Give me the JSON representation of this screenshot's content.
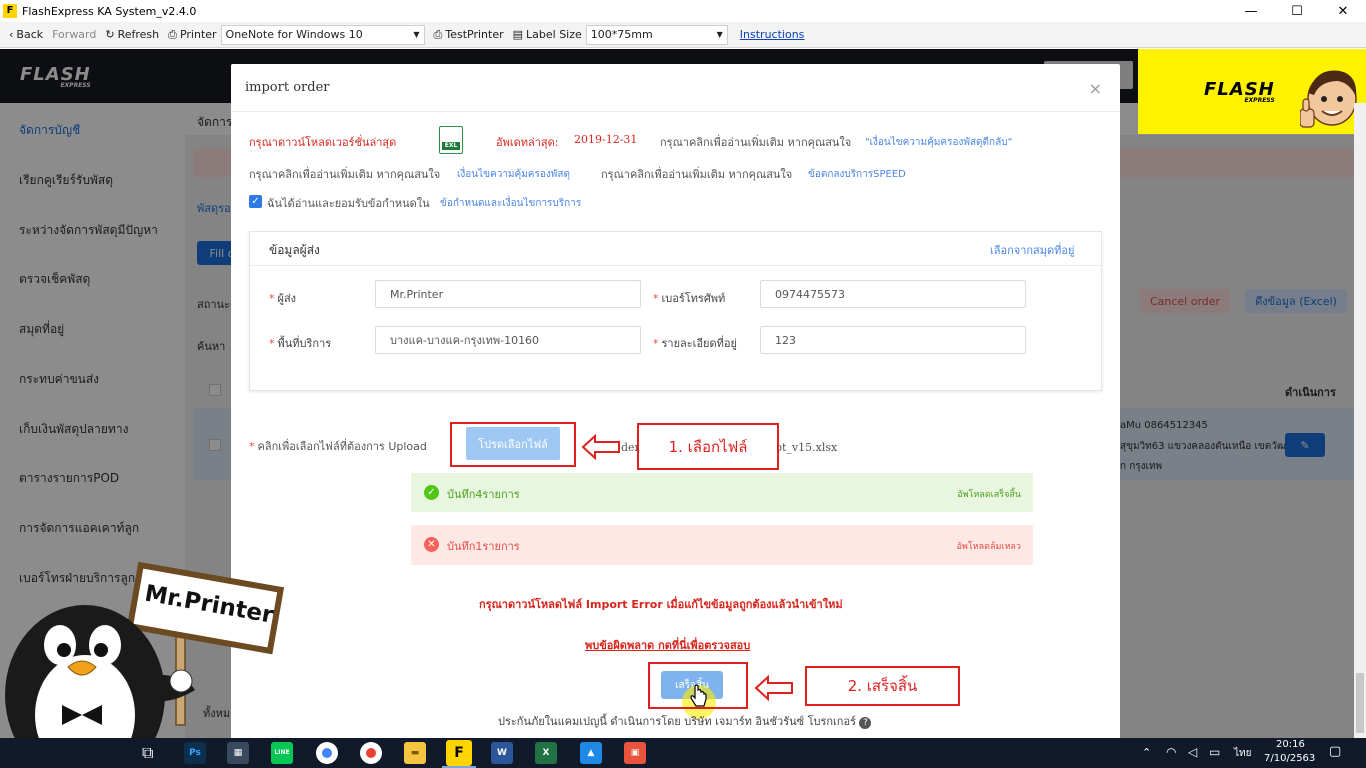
{
  "window": {
    "title": "FlashExpress KA System_v2.4.0",
    "minimize": "—",
    "maximize": "☐",
    "close": "✕"
  },
  "toolbar": {
    "back": "Back",
    "forward": "Forward",
    "refresh": "Refresh",
    "printer_label": "Printer",
    "printer_value": "OneNote for Windows 10",
    "test_printer": "TestPrinter",
    "label_size_label": "Label Size",
    "label_size_value": "100*75mm",
    "instructions": "Instructions"
  },
  "background_app": {
    "logo": "FLASH",
    "logo_sub": "EXPRESS",
    "sidebar": [
      "จัดการบัญชี",
      "เรียกคูเรียร์รับพัสดุ",
      "ระหว่างจัดการพัสดุมีปัญหา",
      "ตรวจเช็คพัสดุ",
      "สมุดที่อยู่",
      "กระทบค่าขนส่ง",
      "เก็บเงินพัสดุปลายทาง",
      "ตารางรายการPOD",
      "การจัดการแอคเคาท์ลูก",
      "เบอร์โทรฝ่ายบริการลูกค้า"
    ],
    "main_title": "จัดการ",
    "tab_label": "พัสดุรอ",
    "fill_btn": "Fill o",
    "status_label": "สถานะดำ",
    "search_label": "ค้นหา",
    "cancel_order": "Cancel order",
    "export_excel": "ดึงข้อมูล (Excel)",
    "action_header": "ดำเนินการ",
    "row_phone": "aMu 0864512345",
    "row_address": "สุขุมวิท63 แขวงคลองตันเหนือ เขตวัฒ",
    "row_city": "ก กรุงเทพ",
    "footer_text": "ทั้งหม"
  },
  "modal": {
    "title": "import order",
    "close_icon": "×",
    "download_latest": "กรุณาดาวน์โหลดเวอร์ชั่นล่าสุด",
    "excel_badge": "EXL",
    "updated_label": "อัพเดทล่าสุด:",
    "updated_date": "2019-12-31",
    "read_more_1": "กรุณาคลิกเพื่ออ่านเพิ่มเติม หากคุณสนใจ",
    "read_more_1_link": "\"เงื่อนไขความคุ้มครองพัสดุตีกลับ\"",
    "read_more_2": "กรุณาคลิกเพื่ออ่านเพิ่มเติม หากคุณสนใจ",
    "read_more_2_link": "เงื่อนไขความคุ้มครองพัสดุ",
    "read_more_3": "กรุณาคลิกเพื่ออ่านเพิ่มเติม หากคุณสนใจ",
    "read_more_3_link": "ข้อตกลงบริการSPEED",
    "accept_text": "ฉันได้อ่านและยอมรับข้อกำหนดใน",
    "accept_link": "ข้อกำหนดและเงื่อนไขการบริการ",
    "sender_card": {
      "title": "ข้อมูลผู้ส่ง",
      "choose_address": "เลือกจากสมุดที่อยู่",
      "sender_label": "ผู้ส่ง",
      "sender_value": "Mr.Printer",
      "phone_label": "เบอร์โทรศัพท์",
      "phone_value": "0974475573",
      "area_label": "พื้นที่บริการ",
      "area_value": "บางแค-บางแค-กรุงเทพ-10160",
      "address_label": "รายละเอียดที่อยู่",
      "address_value": "123"
    },
    "upload_label": "คลิกเพื่อเลือกไฟล์ที่ต้องการ Upload",
    "upload_button": "โปรดเลือกไฟล์",
    "file_name_left": "der",
    "file_name_right": "pt_v15.xlsx",
    "success_text": "บันทึก4รายการ",
    "success_status": "อัพโหลดเสร็จสิ้น",
    "error_text": "บันทึก1รายการ",
    "error_status": "อัพโหลดล้มเหลว",
    "error_instruction": "กรุณาดาวน์โหลดไฟล์ Import Error เมื่อแก้ไขข้อมูลถูกต้องแล้วนำเข้าใหม่",
    "error_link": "พบข้อผิดพลาด กดที่นี่เพื่อตรวจสอบ",
    "finish_button": "เสร็จสิ้น",
    "insurance_footer": "ประกันภัยในแคมเปญนี้ ดำเนินการโดย บริษัท เจมาร์ท อินชัวรันซ์ โบรกเกอร์"
  },
  "annotations": {
    "step1": "1. เลือกไฟล์",
    "step2": "2. เสร็จสิ้น"
  },
  "brand_corner": {
    "logo": "FLASH",
    "logo_sub": "EXPRESS"
  },
  "mascot": {
    "sign": "Mr.Printer"
  },
  "taskbar": {
    "ps": "Ps",
    "line": "LINE",
    "word": "W",
    "excel": "X",
    "language": "ไทย",
    "time": "20:16",
    "date": "7/10/2563"
  },
  "colors": {
    "accent_blue": "#1d6fde",
    "annotation_red": "#e01f1f",
    "brand_yellow": "#fff200"
  }
}
